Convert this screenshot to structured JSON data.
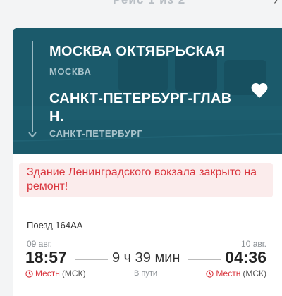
{
  "top": {
    "partial_title": "Рейс 1 из 2"
  },
  "route": {
    "from_station": "МОСКВА ОКТЯБРЬСКАЯ",
    "from_city": "МОСКВА",
    "to_station": "САНКТ-ПЕТЕРБУРГ-ГЛАВН.",
    "to_city": "САНКТ-ПЕТЕРБУРГ"
  },
  "alert": {
    "text": "Здание Ленинградского вокзала закрыто на ремонт!"
  },
  "train": {
    "number_label": "Поезд 164АА",
    "departure": {
      "date": "09 авг.",
      "time": "18:57",
      "tz_label": "Местн",
      "tz_zone": "(МСК)"
    },
    "arrival": {
      "date": "10 авг.",
      "time": "04:36",
      "tz_label": "Местн",
      "tz_zone": "(МСК)"
    },
    "duration": "9 ч 39 мин",
    "duration_label": "В пути"
  },
  "colors": {
    "hero": "#1b5a6b",
    "alert_bg": "#fbecec",
    "alert_text": "#d9363e",
    "accent": "#d9363e"
  }
}
